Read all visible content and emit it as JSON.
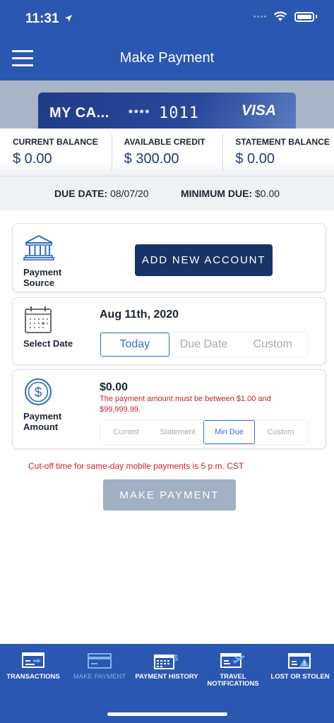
{
  "status": {
    "time": "11:31"
  },
  "header": {
    "title": "Make Payment"
  },
  "card": {
    "name": "MY CA...",
    "masked": "****",
    "last4": "1011",
    "network": "VISA"
  },
  "balances": [
    {
      "label": "CURRENT BALANCE",
      "value": "$ 0.00"
    },
    {
      "label": "AVAILABLE CREDIT",
      "value": "$ 300.00"
    },
    {
      "label": "STATEMENT BALANCE",
      "value": "$ 0.00"
    }
  ],
  "due": {
    "date_label": "DUE DATE:",
    "date_value": "08/07/20",
    "min_label": "MINIMUM DUE:",
    "min_value": "$0.00"
  },
  "source": {
    "label": "Payment Source",
    "button": "ADD NEW ACCOUNT"
  },
  "date": {
    "label": "Select Date",
    "value": "Aug 11th, 2020",
    "options": [
      "Today",
      "Due Date",
      "Custom"
    ],
    "selected": "Today"
  },
  "amount": {
    "label": "Payment Amount",
    "value": "$0.00",
    "error": "The payment amount must be between $1.00 and $99,999.99.",
    "options": [
      "Current",
      "Statement",
      "Min Due",
      "Custom"
    ],
    "selected": "Min Due"
  },
  "cutoff": "Cut-off time for same-day mobile payments is 5 p.m. CST",
  "make_payment": "MAKE PAYMENT",
  "tabs": [
    {
      "label": "TRANSACTIONS",
      "icon": "transactions-icon"
    },
    {
      "label": "MAKE PAYMENT",
      "icon": "card-icon",
      "active": true
    },
    {
      "label": "PAYMENT HISTORY",
      "icon": "calendar-dollar-icon"
    },
    {
      "label": "TRAVEL NOTIFICATIONS",
      "icon": "card-plane-icon"
    },
    {
      "label": "LOST OR STOLEN",
      "icon": "card-warning-icon"
    }
  ],
  "colors": {
    "brand": "#2a57b1",
    "navy": "#183466",
    "accent": "#3a6fcb",
    "error": "#c8232b"
  }
}
